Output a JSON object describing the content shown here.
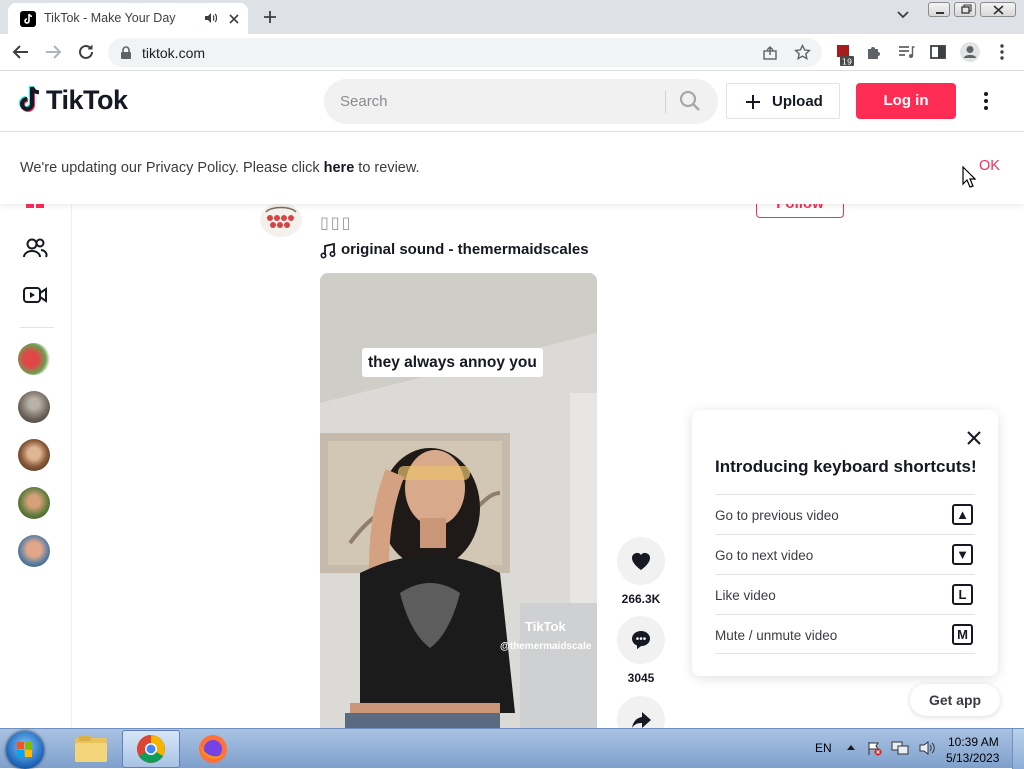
{
  "browser": {
    "tab_title": "TikTok - Make Your Day",
    "url": "tiktok.com",
    "extension_badge": "19"
  },
  "header": {
    "logo": "TikTok",
    "search_placeholder": "Search",
    "upload_label": "Upload",
    "login_label": "Log in"
  },
  "privacy_banner": {
    "text_before": "We're updating our Privacy Policy. Please click ",
    "link": "here",
    "text_after": " to review.",
    "ok_label": "OK"
  },
  "post": {
    "author_name": "▯▯▯",
    "follow_label": "Follow",
    "music": "original sound - themermaidscales",
    "caption": "they always annoy you",
    "watermark_brand": "TikTok",
    "watermark_user": "@themermaidscale",
    "likes": "266.3K",
    "comments": "3045"
  },
  "shortcuts": {
    "title": "Introducing keyboard shortcuts!",
    "items": [
      {
        "label": "Go to previous video",
        "key": "▲"
      },
      {
        "label": "Go to next video",
        "key": "▼"
      },
      {
        "label": "Like video",
        "key": "L"
      },
      {
        "label": "Mute / unmute video",
        "key": "M"
      }
    ]
  },
  "get_app_label": "Get app",
  "taskbar": {
    "language": "EN",
    "time": "10:39 AM",
    "date": "5/13/2023"
  },
  "colors": {
    "brand": "#fe2c55",
    "text": "#161823"
  }
}
